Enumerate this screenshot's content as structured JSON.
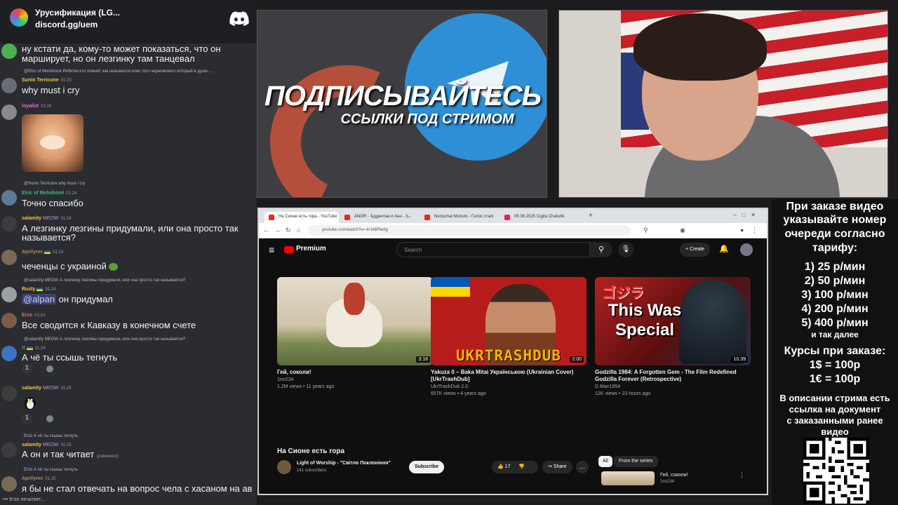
{
  "discord": {
    "server_title": "Урусификация (LG...",
    "invite": "discord.gg/uem",
    "typing": "Erzo печатает..."
  },
  "chat": [
    {
      "id": "m0",
      "username": "",
      "time": "",
      "text": "ну кстати да, кому-то может показаться, что он",
      "text2": "марширует, но он лезгинку там танцевал"
    },
    {
      "id": "m1",
      "reply": "@Elric of Melniboné Ребятки кто помнит как назывался клип того черножокего который в душе ...",
      "username": "Sunio Terricone",
      "time": "01:23",
      "text": "why must i cry"
    },
    {
      "id": "m2",
      "username": "loyalist",
      "time": "01:24",
      "text": ""
    },
    {
      "id": "m3",
      "reply": "@Sunio Terricone why must i cry",
      "username": "Elric of Melniboné",
      "time": "01:24",
      "text": "Точно спасибо"
    },
    {
      "id": "m4",
      "username": "salamity",
      "tag": "MEOW",
      "time": "01:24",
      "text": "А лезгинку лезгины придумали, или она просто так",
      "text2": "называется?"
    },
    {
      "id": "m5",
      "username": "Aprilyrec",
      "time": "01:24",
      "text": "чеченцы с украиной"
    },
    {
      "id": "m6",
      "reply": "@salamity MEOW А лезгинку лезгины придумали, или она просто так называется?",
      "username": "Rusty",
      "time": "01:24",
      "mention": "@alpan",
      "text": "он придумал"
    },
    {
      "id": "m7",
      "username": "Erzo",
      "time": "01:24",
      "text": "Все сводится к Кавказу в конечном счете"
    },
    {
      "id": "m8",
      "reply": "@salamity MEOW А лезгинку лезгины придумали, или она просто так называется?",
      "username": "!!",
      "time": "01:24",
      "text": "А чё ты ссышь тегнуть",
      "reaction": "1"
    },
    {
      "id": "m9",
      "username": "salamity",
      "tag": "MEOW",
      "time": "01:25",
      "text": "",
      "reaction": "1"
    },
    {
      "id": "m10",
      "reply": "Erzo А чё ты ссышь тегнуть",
      "username": "salamity",
      "tag": "MEOW",
      "time": "01:25",
      "text": "А он и так читает",
      "edited": "(изменено)"
    },
    {
      "id": "m11",
      "reply": "Erzo А чё ты ссышь тегнуть",
      "username": "Aprilyrec",
      "time": "01:25",
      "text": "я бы не стал отвечать на вопрос чела с хасаном на ав"
    }
  ],
  "banner": {
    "title": "ПОДПИСЫВАЙТЕСЬ",
    "subtitle": "ССЫЛКИ ПОД СТРИМОМ"
  },
  "panel": {
    "intro": [
      "При заказе видео",
      "указывайте номер",
      "очереди согласно",
      "тарифу:"
    ],
    "tariffs": [
      "1) 25 р/мин",
      "2) 50 р/мин",
      "3) 100 р/мин",
      "4) 200 р/мин",
      "5) 400 р/мин"
    ],
    "etc": "и так далее",
    "rates_title": "Курсы при заказе:",
    "rates": [
      "1$ = 100р",
      "1€ = 100р"
    ],
    "note": [
      "В описании стрима есть",
      "ссылка на документ",
      "с заказанными ранее",
      "видео"
    ]
  },
  "browser": {
    "tabs": [
      "На Сионе есть гора - YouTube",
      "ANOR - Ъддентан и Анн - Ъ...",
      "Nocturnal Mortum - Голос сталі",
      "05 06 2025 Cigita Chaturbi"
    ],
    "url": "youtube.com/watch?v=-kl ln6Plwdg"
  },
  "youtube": {
    "brand": "Premium",
    "search_placeholder": "Search",
    "create_label": "Create",
    "videos": [
      {
        "title": "Гей, соколи!",
        "channel": "1nn234",
        "meta": "1.2M views • 11 years ago",
        "duration": "3:18"
      },
      {
        "title": "Yakuza 0 – Baka Mitai Українською (Ukrainian Cover) [UkrTrashDub]",
        "channel": "UkrTrashDub 2.0",
        "meta": "657K views • 4 years ago",
        "duration": "2:00",
        "thumb_text": "UKRTRASHDUB"
      },
      {
        "title": "Godzilla 1984: A Forgotten Gem - The Film Redefined Godzilla Forever (Retrospective)",
        "channel": "D Man1954",
        "meta": "12K views • 23 hours ago",
        "duration": "10:39",
        "thumb_text": "This Was Special",
        "thumb_jp": "ゴジラ"
      }
    ],
    "now_playing": {
      "title": "На Сионе есть гора",
      "channel": "Light of Worship - \"Світло Поклоніння\"",
      "subscribers": "141 subscribers",
      "subscribe_label": "Subscribe",
      "likes": "17",
      "share_label": "Share"
    },
    "chips": [
      "All",
      "From the series"
    ],
    "side_item": {
      "title": "Гей, соколи!",
      "sub": "1nn234"
    }
  },
  "colors": {
    "discord_bg": "#2b2c30",
    "youtube_red": "#ff0000",
    "telegram_blue": "#2f8fd6",
    "patreon_orange": "#c9523a"
  }
}
